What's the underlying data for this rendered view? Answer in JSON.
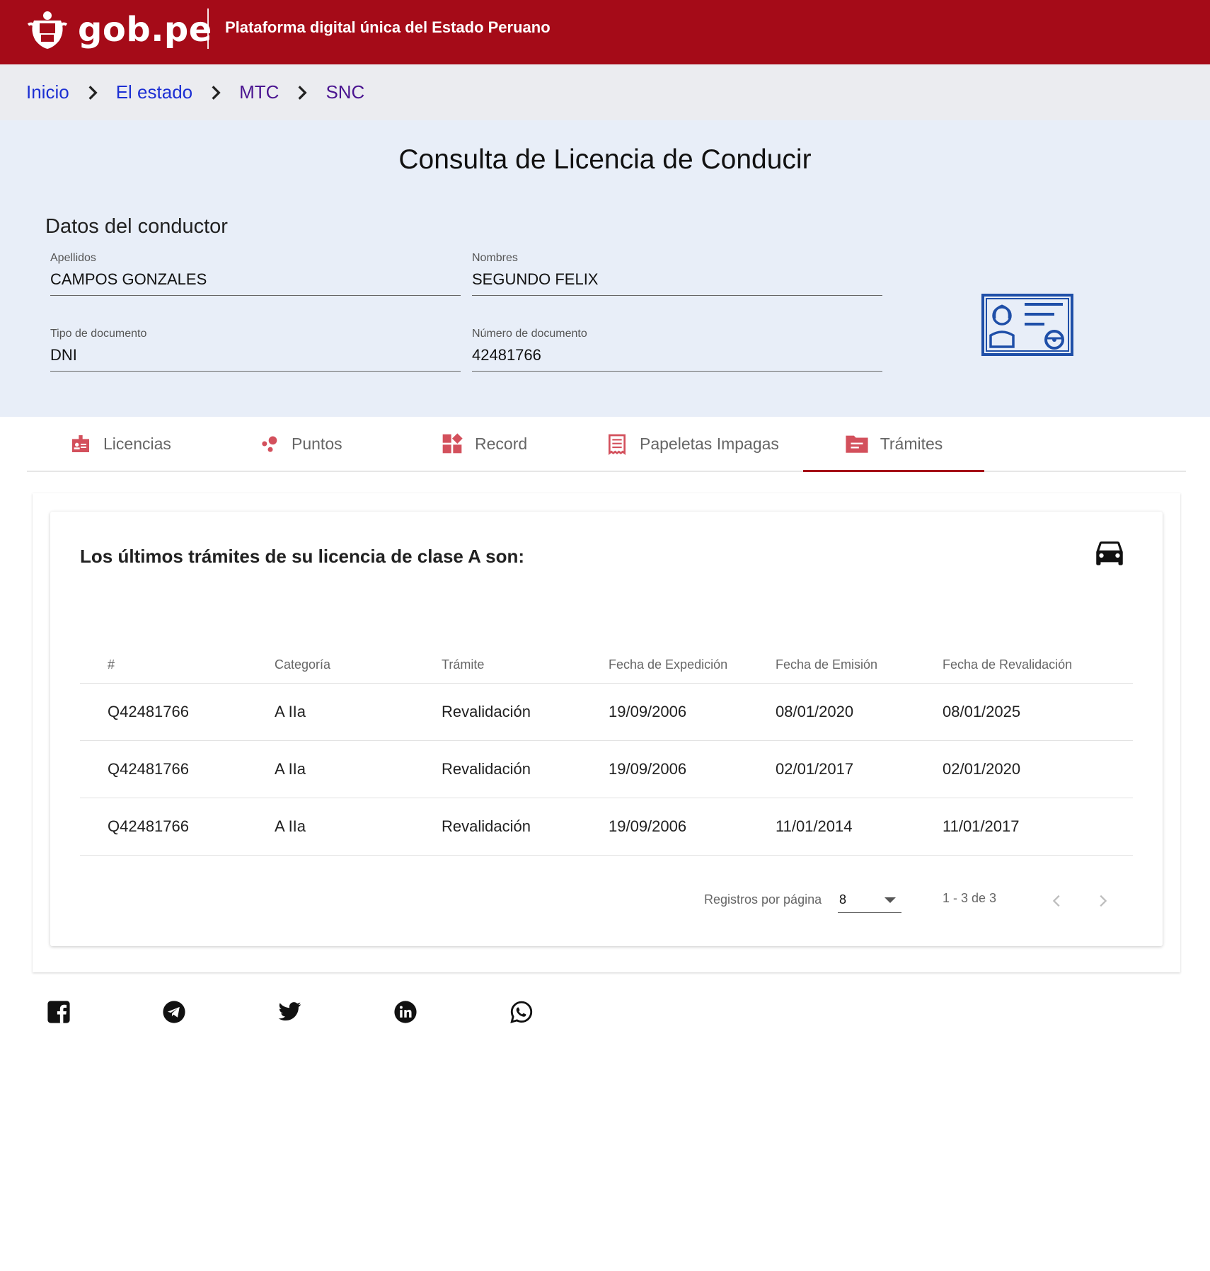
{
  "header": {
    "logo_text": "gob.pe",
    "tagline": "Plataforma digital única del Estado Peruano",
    "brand_color": "#a50b18"
  },
  "breadcrumb": [
    {
      "label": "Inicio"
    },
    {
      "label": "El estado"
    },
    {
      "label": "MTC"
    },
    {
      "label": "SNC"
    }
  ],
  "page": {
    "title": "Consulta de Licencia de Conducir",
    "section_title": "Datos del conductor"
  },
  "driver": {
    "apellidos_label": "Apellidos",
    "apellidos": "CAMPOS GONZALES",
    "nombres_label": "Nombres",
    "nombres": "SEGUNDO FELIX",
    "tipo_doc_label": "Tipo de documento",
    "tipo_doc": "DNI",
    "num_doc_label": "Número de documento",
    "num_doc": "42481766"
  },
  "tabs": [
    {
      "label": "Licencias",
      "icon": "id-badge-icon"
    },
    {
      "label": "Puntos",
      "icon": "points-icon"
    },
    {
      "label": "Record",
      "icon": "record-grid-icon"
    },
    {
      "label": "Papeletas Impagas",
      "icon": "receipt-icon"
    },
    {
      "label": "Trámites",
      "icon": "folder-icon",
      "active": true
    }
  ],
  "tramites": {
    "heading": "Los últimos trámites de su licencia de clase A son:",
    "columns": [
      "#",
      "Categoría",
      "Trámite",
      "Fecha de Expedición",
      "Fecha de Emisión",
      "Fecha de Revalidación"
    ],
    "rows": [
      [
        "Q42481766",
        "A IIa",
        "Revalidación",
        "19/09/2006",
        "08/01/2020",
        "08/01/2025"
      ],
      [
        "Q42481766",
        "A IIa",
        "Revalidación",
        "19/09/2006",
        "02/01/2017",
        "02/01/2020"
      ],
      [
        "Q42481766",
        "A IIa",
        "Revalidación",
        "19/09/2006",
        "11/01/2014",
        "11/01/2017"
      ]
    ]
  },
  "pager": {
    "label": "Registros por página",
    "page_size": "8",
    "range": "1 - 3 de 3"
  },
  "social": [
    "facebook-icon",
    "telegram-icon",
    "twitter-icon",
    "linkedin-icon",
    "whatsapp-icon"
  ]
}
